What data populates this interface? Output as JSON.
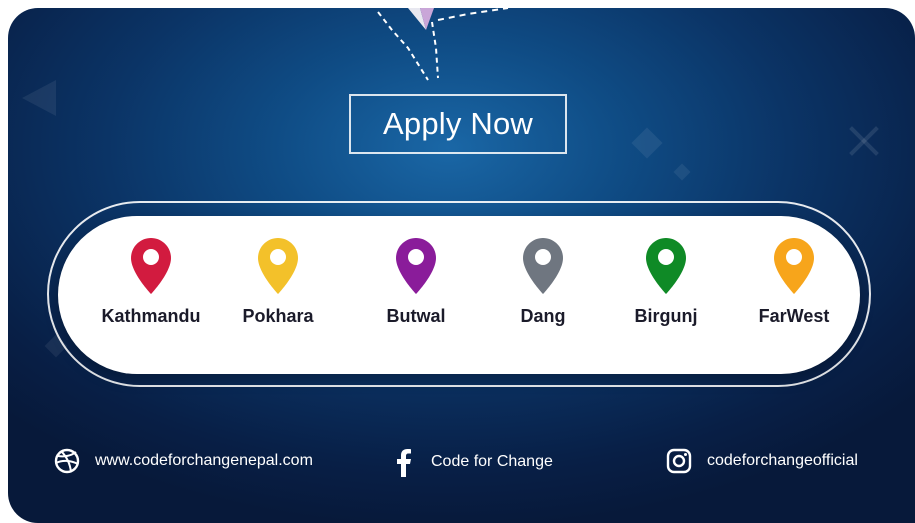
{
  "cta": {
    "label": "Apply Now"
  },
  "locations": [
    {
      "name": "Kathmandu",
      "color": "#d21b3f"
    },
    {
      "name": "Pokhara",
      "color": "#f3c12a"
    },
    {
      "name": "Butwal",
      "color": "#8a1c9a"
    },
    {
      "name": "Dang",
      "color": "#6f7680"
    },
    {
      "name": "Birgunj",
      "color": "#0f8a26"
    },
    {
      "name": "FarWest",
      "color": "#f7a51b"
    }
  ],
  "footer": {
    "website": {
      "icon": "dribbble-icon",
      "text": "www.codeforchangenepal.com"
    },
    "facebook": {
      "icon": "facebook-icon",
      "text": "Code for Change"
    },
    "instagram": {
      "icon": "instagram-icon",
      "text": "codeforchangeofficial"
    }
  },
  "theme": {
    "background": "#0b3466",
    "accent": "#1a67a6",
    "pill": "#ffffff"
  }
}
